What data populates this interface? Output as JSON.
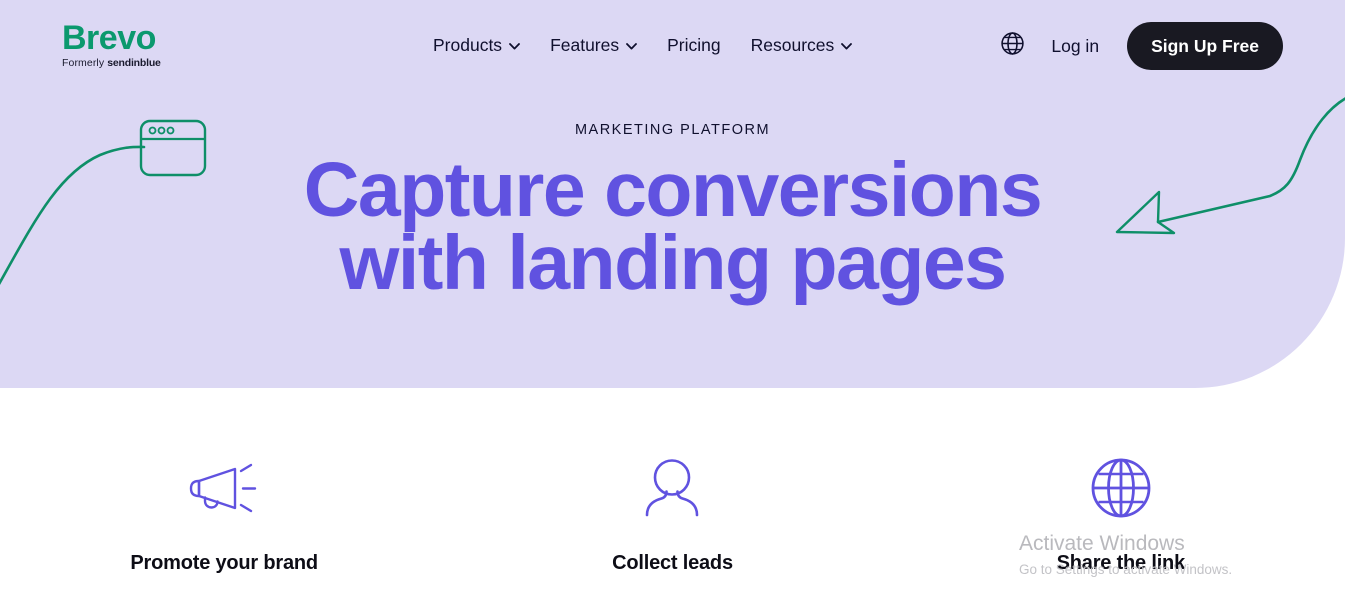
{
  "brand": {
    "logo_text": "Brevo",
    "logo_sub_prefix": "Formerly",
    "logo_sub_name": "sendinblue",
    "logo_color": "#0b996e"
  },
  "nav": {
    "items": [
      {
        "label": "Products",
        "has_dropdown": true,
        "icon": "chevron-down-icon"
      },
      {
        "label": "Features",
        "has_dropdown": true,
        "icon": "chevron-down-icon"
      },
      {
        "label": "Pricing",
        "has_dropdown": false,
        "icon": ""
      },
      {
        "label": "Resources",
        "has_dropdown": true,
        "icon": "chevron-down-icon"
      }
    ],
    "language_icon": "globe-icon",
    "login_label": "Log in",
    "signup_label": "Sign Up Free",
    "signup_bg": "#191922"
  },
  "hero": {
    "eyebrow": "MARKETING PLATFORM",
    "title_line1": "Capture conversions",
    "title_line2": "with landing pages",
    "title_color": "#6052e0",
    "background_color": "#dcd8f4",
    "decorations": [
      {
        "name": "browser-window-illustration",
        "color": "#0e8f68"
      },
      {
        "name": "curved-line-illustration",
        "color": "#0e8f68"
      },
      {
        "name": "arrow-illustration",
        "color": "#0e8f68"
      }
    ]
  },
  "features": [
    {
      "icon": "megaphone-icon",
      "label": "Promote your brand",
      "icon_color": "#6052e0"
    },
    {
      "icon": "person-icon",
      "label": "Collect leads",
      "icon_color": "#6052e0"
    },
    {
      "icon": "globe-icon",
      "label": "Share the link",
      "icon_color": "#6052e0"
    }
  ],
  "watermark": {
    "title": "Activate Windows",
    "subtitle": "Go to Settings to activate Windows."
  }
}
